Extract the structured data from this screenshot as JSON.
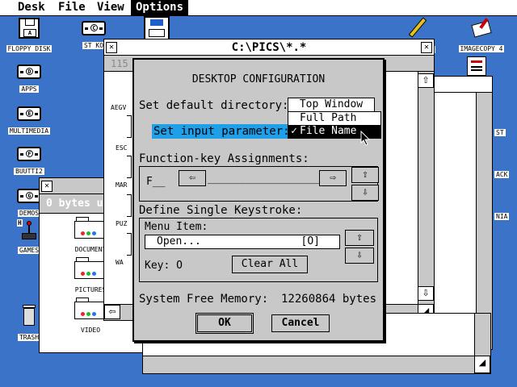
{
  "menubar": {
    "items": [
      {
        "label": "Desk"
      },
      {
        "label": "File"
      },
      {
        "label": "View"
      },
      {
        "label": "Options"
      }
    ]
  },
  "desktop": {
    "left_icons": [
      {
        "label": "FLOPPY DISK",
        "letter": "A"
      },
      {
        "label": "APPS",
        "letter": "D"
      },
      {
        "label": "MULTIMEDIA",
        "letter": "E"
      },
      {
        "label": "BUUTTI2",
        "letter": "F"
      },
      {
        "label": "DEMOS",
        "letter": "G"
      },
      {
        "label": "GAMES",
        "letter": "H"
      },
      {
        "label": "TRASH",
        "letter": ""
      }
    ],
    "top_icons": [
      {
        "label": "ST KO",
        "letter": "C"
      },
      {
        "label": "2",
        "letter": ""
      },
      {
        "label": "IMAGECOPY 4",
        "letter": ""
      }
    ],
    "right_partial_labels": [
      "ST",
      "ACK",
      "NIA"
    ]
  },
  "back_window": {
    "title": "0 bytes u",
    "folders": [
      {
        "label": "DOCUMENT"
      },
      {
        "label": "PICTURES"
      },
      {
        "label": "VIDEO"
      }
    ]
  },
  "mid_window": {
    "title": "C:\\PICS\\*.*",
    "info_fragment": "115",
    "list_fragments": [
      "AEGV",
      "ESC",
      "MAR",
      "PUZ",
      "WA"
    ]
  },
  "dialog": {
    "title": "DESKTOP CONFIGURATION",
    "default_dir_label": "Set default directory:",
    "default_dir_value": "Top Window",
    "input_param_label": "Set input parameter:",
    "popup_options": [
      {
        "label": "Full Path",
        "checked": false
      },
      {
        "label": "File Name",
        "checked": true
      }
    ],
    "check_mark": "✓",
    "fkey_label": "Function-key Assignments:",
    "fkey_value": "F__",
    "fkey_field": "__________________",
    "keystroke_label": "Define Single Keystroke:",
    "menu_item_label": "Menu Item:",
    "menu_item_value": "Open...",
    "menu_item_shortcut": "[O]",
    "key_label": "Key: O",
    "clear_all": "Clear All",
    "memory_label": "System Free Memory:",
    "memory_value": "12260864 bytes",
    "ok": "OK",
    "cancel": "Cancel"
  }
}
